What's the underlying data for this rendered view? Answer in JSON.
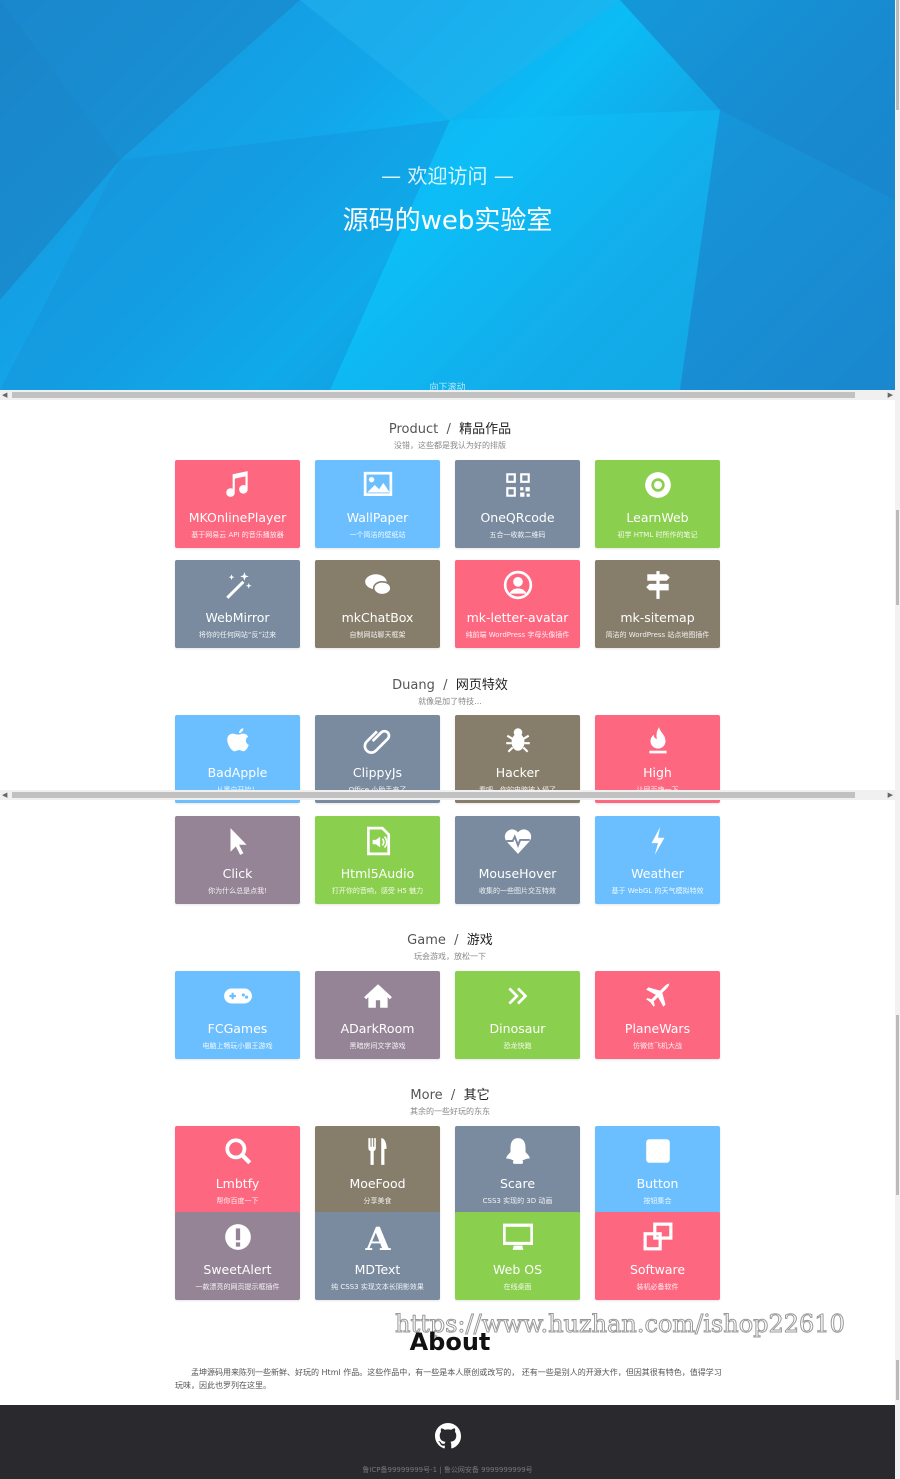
{
  "hero": {
    "welcome": "— 欢迎访问 —",
    "title": "源码的web实验室",
    "scroll_hint": "向下滚动"
  },
  "colors": {
    "red": "#fe6780",
    "blue": "#6cbfff",
    "slate": "#7a8ba0",
    "green": "#8bcf4e",
    "khaki": "#877d6b",
    "mauve": "#958496",
    "footer": "#2a2a2e"
  },
  "sections": [
    {
      "en": "Product",
      "sep": "/",
      "cn": "精品作品",
      "sub": "没错，这些都是我认为好的排版"
    },
    {
      "en": "Duang",
      "sep": "/",
      "cn": "网页特效",
      "sub": "就像是加了特技..."
    },
    {
      "en": "Game",
      "sep": "/",
      "cn": "游戏",
      "sub": "玩会游戏，放松一下"
    },
    {
      "en": "More",
      "sep": "/",
      "cn": "其它",
      "sub": "其余的一些好玩的东东"
    }
  ],
  "cards": [
    {
      "name": "MKOnlinePlayer",
      "desc": "基于网易云 API 的音乐播放器",
      "color": "red",
      "icon": "music-icon"
    },
    {
      "name": "WallPaper",
      "desc": "一个简洁的壁纸站",
      "color": "blue",
      "icon": "image-icon"
    },
    {
      "name": "OneQRcode",
      "desc": "五合一收款二维码",
      "color": "slate",
      "icon": "qrcode-icon"
    },
    {
      "name": "LearnWeb",
      "desc": "初学 HTML 时所作的笔记",
      "color": "green",
      "icon": "chrome-icon"
    },
    {
      "name": "WebMirror",
      "desc": "将你的任何网站“反”过来",
      "color": "slate",
      "icon": "magic-wand-icon"
    },
    {
      "name": "mkChatBox",
      "desc": "自制网站聊天框架",
      "color": "khaki",
      "icon": "chat-icon"
    },
    {
      "name": "mk-letter-avatar",
      "desc": "纯前端 WordPress 字母头像插件",
      "color": "red",
      "icon": "user-circle-icon"
    },
    {
      "name": "mk-sitemap",
      "desc": "简洁的 WordPress 站点地图插件",
      "color": "khaki",
      "icon": "signpost-icon"
    },
    {
      "name": "BadApple",
      "desc": "从黑白开始！",
      "color": "blue",
      "icon": "apple-icon"
    },
    {
      "name": "ClippyJs",
      "desc": "Office 小助手来了",
      "color": "slate",
      "icon": "paperclip-icon"
    },
    {
      "name": "Hacker",
      "desc": "看吧，你的电脑被入侵了",
      "color": "khaki",
      "icon": "bug-icon"
    },
    {
      "name": "High",
      "desc": "让网页嗨一下",
      "color": "red",
      "icon": "fire-icon"
    },
    {
      "name": "Click",
      "desc": "你为什么总是点我!",
      "color": "mauve",
      "icon": "cursor-icon"
    },
    {
      "name": "Html5Audio",
      "desc": "打开你的音响，感受 H5 魅力",
      "color": "green",
      "icon": "audio-file-icon"
    },
    {
      "name": "MouseHover",
      "desc": "收集的一些图片交互特效",
      "color": "slate",
      "icon": "heartbeat-icon"
    },
    {
      "name": "Weather",
      "desc": "基于 WebGL 的天气模拟特效",
      "color": "blue",
      "icon": "bolt-icon"
    },
    {
      "name": "FCGames",
      "desc": "电脑上畅玩小霸王游戏",
      "color": "blue",
      "icon": "gamepad-icon"
    },
    {
      "name": "ADarkRoom",
      "desc": "黑暗房间文字游戏",
      "color": "mauve",
      "icon": "home-icon"
    },
    {
      "name": "Dinosaur",
      "desc": "恐龙快跑",
      "color": "green",
      "icon": "double-chevron-right-icon"
    },
    {
      "name": "PlaneWars",
      "desc": "仿微信飞机大战",
      "color": "red",
      "icon": "plane-icon"
    },
    {
      "name": "Lmbtfy",
      "desc": "帮你百度一下",
      "color": "red",
      "icon": "search-icon"
    },
    {
      "name": "MoeFood",
      "desc": "分享美食",
      "color": "khaki",
      "icon": "cutlery-icon"
    },
    {
      "name": "Scare",
      "desc": "CSS3 实现的 3D 动画",
      "color": "slate",
      "icon": "ghost-icon"
    },
    {
      "name": "Button",
      "desc": "按钮集合",
      "color": "blue",
      "icon": "square-icon"
    },
    {
      "name": "SweetAlert",
      "desc": "一款漂亮的网页提示框插件",
      "color": "mauve",
      "icon": "alert-icon"
    },
    {
      "name": "MDText",
      "desc": "纯 CSS3 实现文本长阴影效果",
      "color": "slate",
      "icon": "font-icon"
    },
    {
      "name": "Web OS",
      "desc": "在线桌面",
      "color": "green",
      "icon": "monitor-icon"
    },
    {
      "name": "Software",
      "desc": "装机必备软件",
      "color": "red",
      "icon": "windows-icon"
    }
  ],
  "about": {
    "title": "About",
    "text": "孟坤源码用来陈列一些新鲜、好玩的 Html 作品。这些作品中，有一些是本人原创或改写的， 还有一些是别人的开源大作，但因其很有特色，值得学习玩味，因此也罗列在这里。"
  },
  "watermark": "https://www.huzhan.com/ishop22610",
  "footer": {
    "icp": "鲁ICP备99999999号-1 | 鲁公网安备 9999999999号",
    "icon": "github-icon"
  }
}
